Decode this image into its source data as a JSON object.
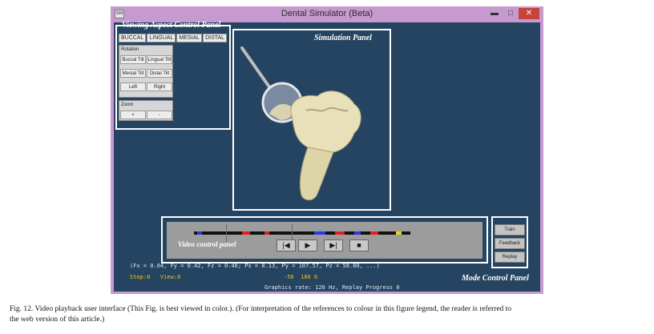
{
  "window": {
    "title": "Dental Simulator (Beta)",
    "icon_label": "SIM",
    "minimize": "▬",
    "maximize": "□",
    "close": "✕"
  },
  "viewing_panel": {
    "title": "Viewing Aspect Control Panel",
    "views": [
      "BUCCAL",
      "LINGUAL",
      "MESIAL",
      "DISTAL"
    ],
    "rotation_label": "Rotation",
    "rotation_buttons": [
      "Buccal Tilt",
      "Lingual Tilt",
      "Mesial Tilt",
      "Distal Tilt",
      "Left",
      "Right"
    ],
    "zoom_label": "Zoom",
    "zoom_buttons": [
      "+",
      "-"
    ]
  },
  "simulation_panel": {
    "title": "Simulation Panel"
  },
  "video_panel": {
    "title": "Video control panel",
    "buttons": [
      "|◀",
      "▶",
      "▶|",
      "■"
    ],
    "timeline_colors": {
      "red": "#e02020",
      "blue": "#2a3adf",
      "yellow": "#e8d020",
      "base": "#111111"
    }
  },
  "mode_panel": {
    "title": "Mode Control Panel",
    "buttons": [
      "Train",
      "Feedback",
      "Replay"
    ]
  },
  "status": {
    "forces": "(Fx = 0.04, Fy = 0.42, Fz = 0.46; Px = 8.13, Py = 107.57, Pz = 58.80, ...)",
    "step_view": "Step:0   View:0",
    "center_value": "-56  186 0",
    "graphics_rate": "Graphics rate: 126 Hz, Replay Progress 0"
  },
  "caption": {
    "line1": "Fig. 12.  Video playback user interface (This Fig. is best viewed in color.). (For interpretation of the references to colour in this figure legend, the reader is referred to",
    "line2": "the web version of this article.)"
  },
  "colors": {
    "window_frame": "#c79acf",
    "client_bg": "#244461",
    "close_button": "#c8413a",
    "tooth": "#e8e0b8"
  }
}
